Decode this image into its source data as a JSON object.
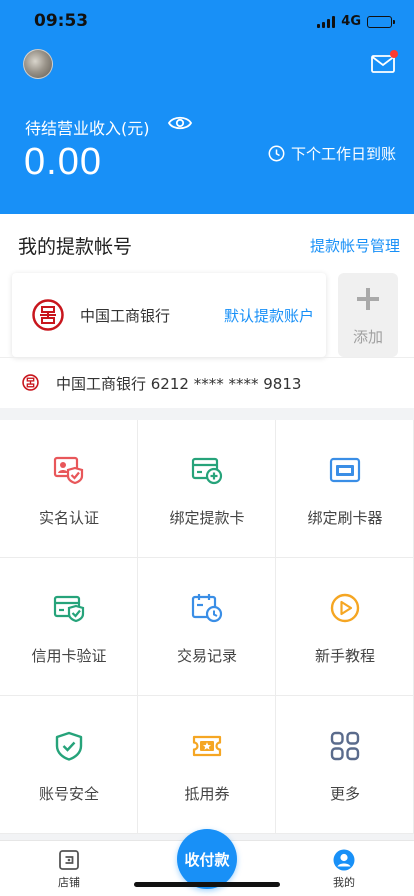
{
  "status_bar": {
    "time": "09:53",
    "network": "4G"
  },
  "header": {
    "income_label": "待结营业收入(元)",
    "income_value": "0.00",
    "settle_text": "下个工作日到账"
  },
  "accounts": {
    "title": "我的提款帐号",
    "manage_link": "提款帐号管理",
    "bank_name": "中国工商银行",
    "default_tag": "默认提款账户",
    "add_label": "添加",
    "card_line": "中国工商银行 6212 **** **** 9813"
  },
  "grid": [
    {
      "label": "实名认证",
      "icon": "id-verify-icon",
      "color": "#e8575a"
    },
    {
      "label": "绑定提款卡",
      "icon": "add-card-icon",
      "color": "#26a37a"
    },
    {
      "label": "绑定刷卡器",
      "icon": "card-reader-icon",
      "color": "#3a8ee6"
    },
    {
      "label": "信用卡验证",
      "icon": "credit-card-verify-icon",
      "color": "#26a37a"
    },
    {
      "label": "交易记录",
      "icon": "calendar-clock-icon",
      "color": "#3a8ee6"
    },
    {
      "label": "新手教程",
      "icon": "play-tutorial-icon",
      "color": "#f5a623"
    },
    {
      "label": "账号安全",
      "icon": "shield-check-icon",
      "color": "#26a37a"
    },
    {
      "label": "抵用券",
      "icon": "coupon-icon",
      "color": "#f5a623"
    },
    {
      "label": "更多",
      "icon": "more-grid-icon",
      "color": "#5a6b8c"
    }
  ],
  "tabbar": {
    "store_label": "店铺",
    "pay_label": "收付款",
    "mine_label": "我的"
  },
  "colors": {
    "brand": "#1890f7",
    "badge": "#ff3b30"
  }
}
